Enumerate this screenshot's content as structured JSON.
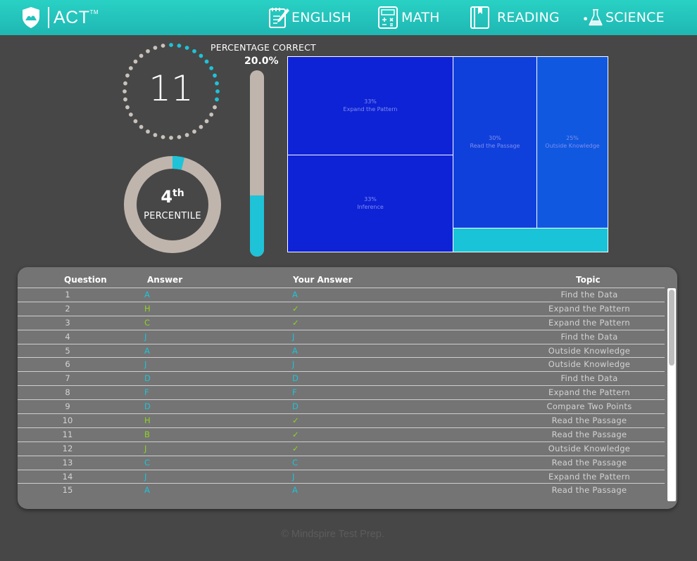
{
  "header": {
    "logo_text": "ACT",
    "logo_tm": "TM",
    "nav": [
      {
        "label": "ENGLISH",
        "icon": "pencil-notebook-icon"
      },
      {
        "label": "MATH",
        "icon": "calculator-icon"
      },
      {
        "label": "READING",
        "icon": "book-icon"
      },
      {
        "label": "SCIENCE",
        "icon": "flask-icon"
      }
    ]
  },
  "score": {
    "value": "11",
    "max": 36
  },
  "percentile": {
    "rank": "4",
    "suffix": "th",
    "label": "PERCENTILE",
    "fraction": 0.04
  },
  "percentage_correct": {
    "title": "PERCENTAGE CORRECT",
    "value": "20.0%",
    "fraction": 0.2
  },
  "treemap": {
    "cells": [
      {
        "pct": "33%",
        "label": "Expand the Pattern",
        "color": "#0e22d6"
      },
      {
        "pct": "33%",
        "label": "Inference",
        "color": "#0e22d6"
      },
      {
        "pct": "30%",
        "label": "Read the Passage",
        "color": "#1040db"
      },
      {
        "pct": "25%",
        "label": "Outside Knowledge",
        "color": "#1058e0"
      },
      {
        "pct": "",
        "label": "",
        "color": "#19c4d8"
      }
    ]
  },
  "table": {
    "headers": {
      "question": "Question",
      "answer": "Answer",
      "your_answer": "Your Answer",
      "topic": "Topic"
    },
    "colors": {
      "wrong": "#1ec3d8",
      "correct": "#8ed422"
    },
    "rows": [
      {
        "q": "1",
        "answer": "A",
        "your": "A",
        "correct": false,
        "topic": "Find the Data"
      },
      {
        "q": "2",
        "answer": "H",
        "your": "✓",
        "correct": true,
        "topic": "Expand the Pattern"
      },
      {
        "q": "3",
        "answer": "C",
        "your": "✓",
        "correct": true,
        "topic": "Expand the Pattern"
      },
      {
        "q": "4",
        "answer": "J",
        "your": "J",
        "correct": false,
        "topic": "Find the Data"
      },
      {
        "q": "5",
        "answer": "A",
        "your": "A",
        "correct": false,
        "topic": "Outside Knowledge"
      },
      {
        "q": "6",
        "answer": "J",
        "your": "J",
        "correct": false,
        "topic": "Outside Knowledge"
      },
      {
        "q": "7",
        "answer": "D",
        "your": "D",
        "correct": false,
        "topic": "Find the Data"
      },
      {
        "q": "8",
        "answer": "F",
        "your": "F",
        "correct": false,
        "topic": "Expand the Pattern"
      },
      {
        "q": "9",
        "answer": "D",
        "your": "D",
        "correct": false,
        "topic": "Compare Two Points"
      },
      {
        "q": "10",
        "answer": "H",
        "your": "✓",
        "correct": true,
        "topic": "Read the Passage"
      },
      {
        "q": "11",
        "answer": "B",
        "your": "✓",
        "correct": true,
        "topic": "Read the Passage"
      },
      {
        "q": "12",
        "answer": "J",
        "your": "✓",
        "correct": true,
        "topic": "Outside Knowledge"
      },
      {
        "q": "13",
        "answer": "C",
        "your": "C",
        "correct": false,
        "topic": "Read the Passage"
      },
      {
        "q": "14",
        "answer": "J",
        "your": "J",
        "correct": false,
        "topic": "Expand the Pattern"
      },
      {
        "q": "15",
        "answer": "A",
        "your": "A",
        "correct": false,
        "topic": "Read the Passage"
      }
    ]
  },
  "footer": {
    "text": "© Mindspire Test Prep."
  }
}
